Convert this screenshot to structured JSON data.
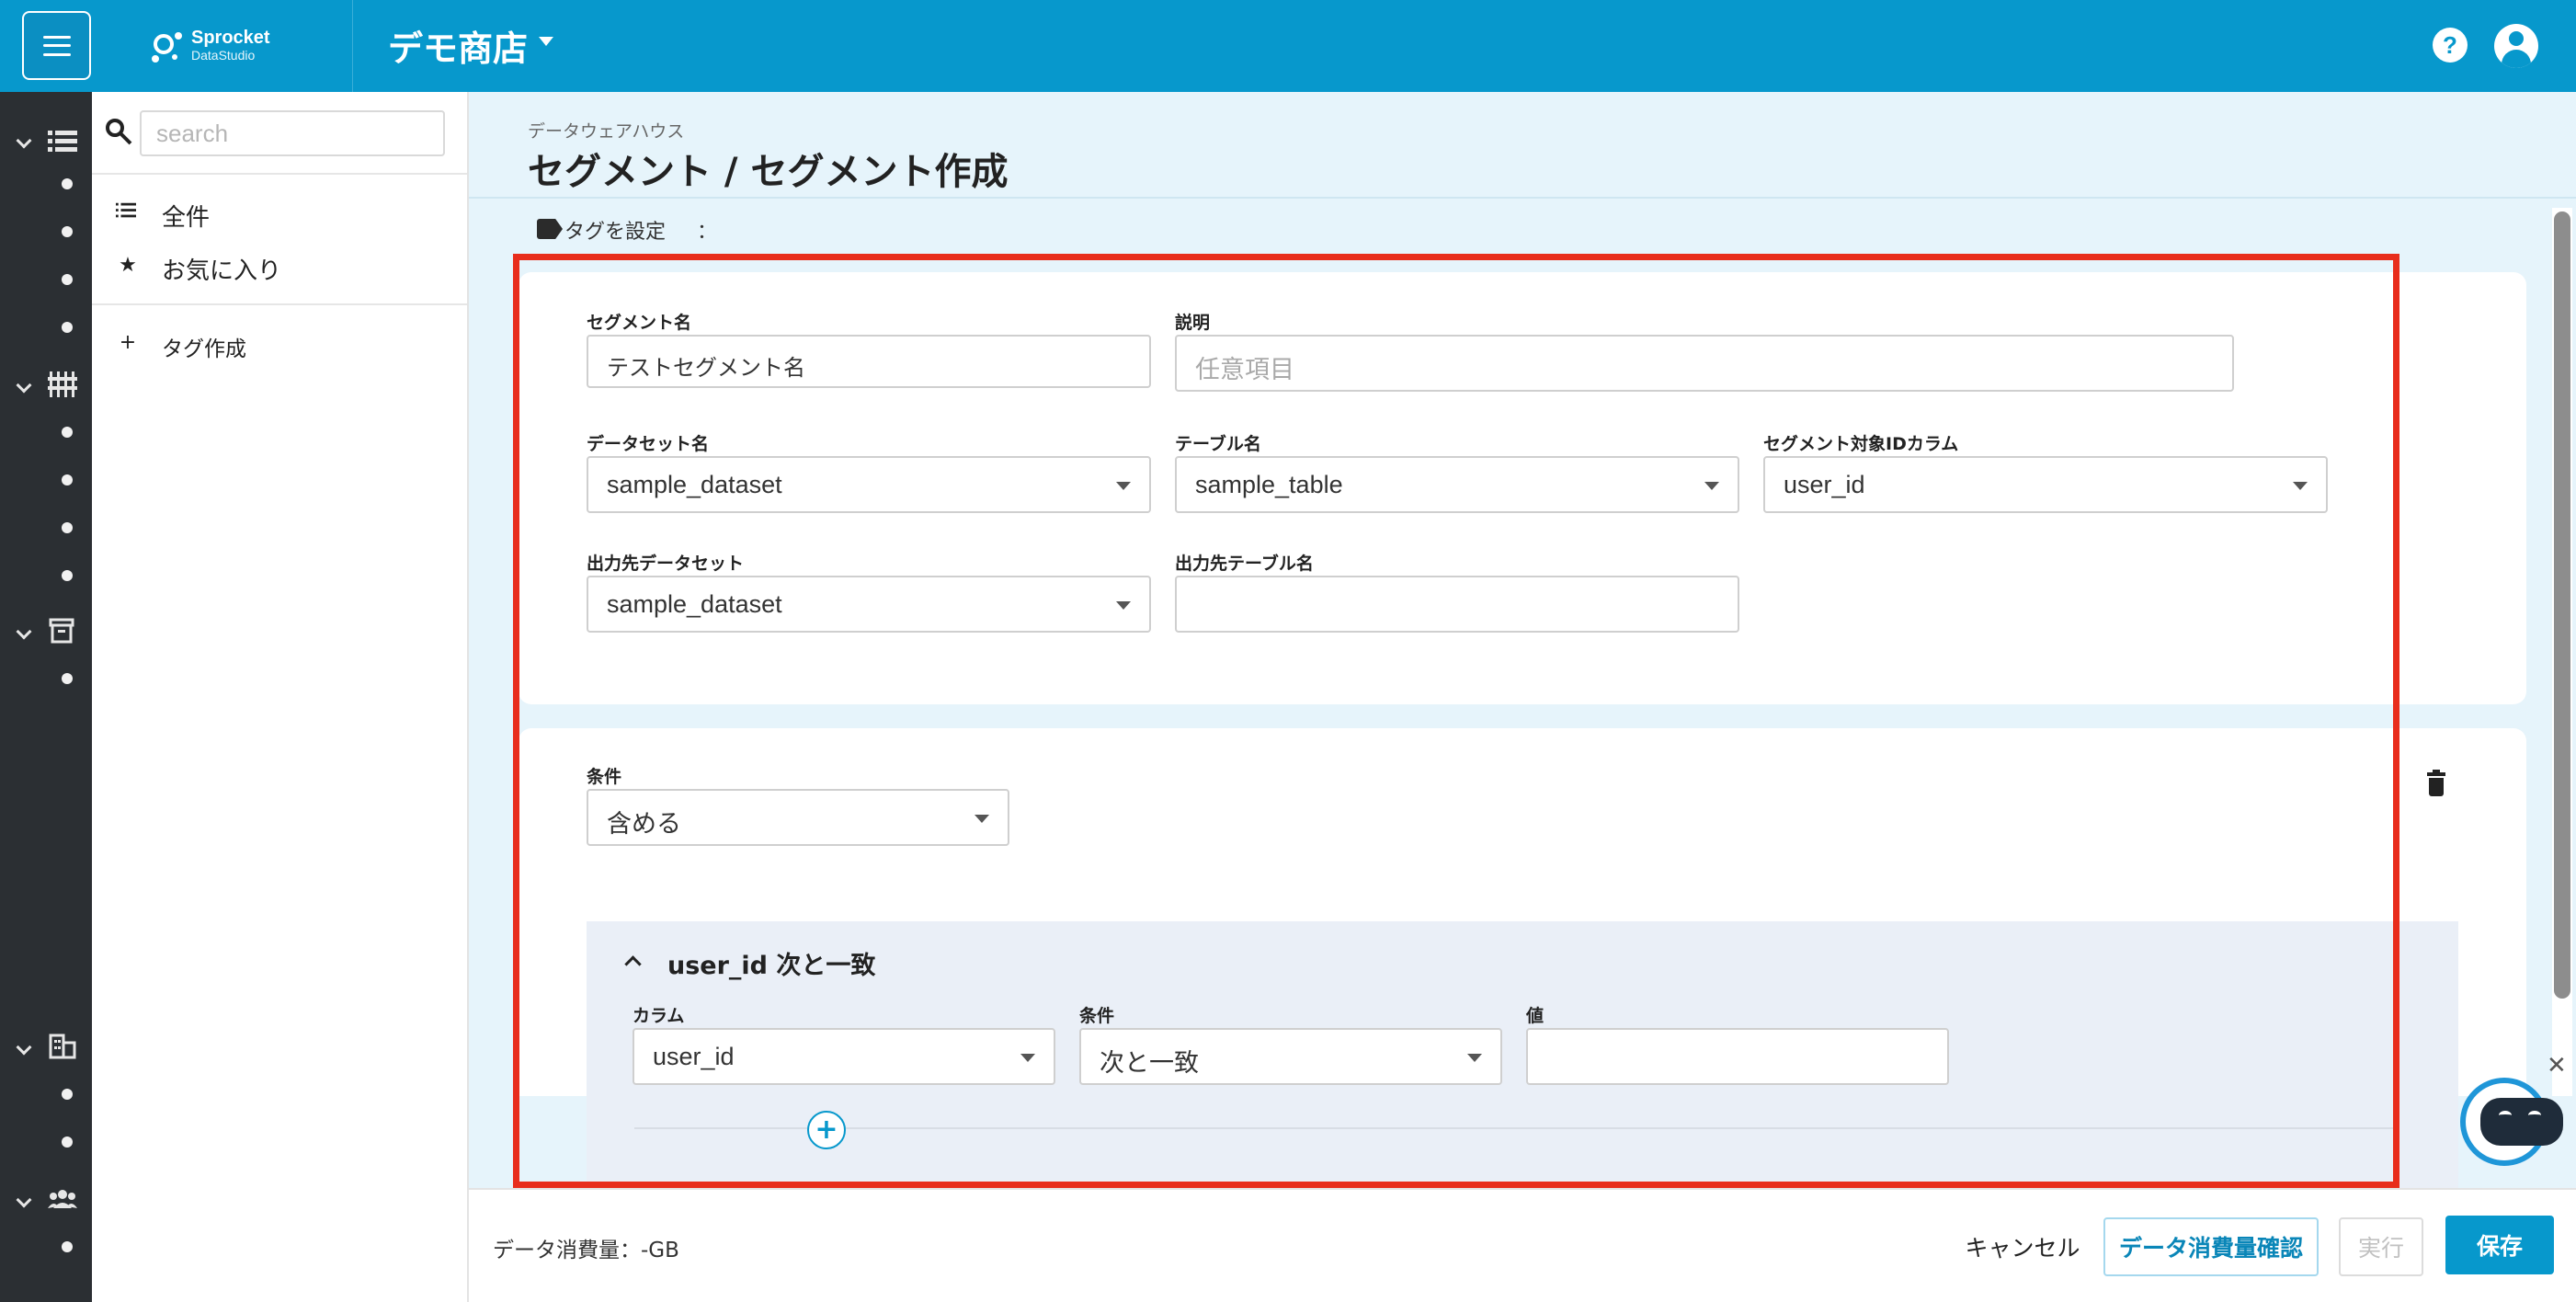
{
  "app": {
    "logo_name": "Sprocket",
    "logo_sub": "DataStudio",
    "shop_name": "デモ商店"
  },
  "sidebar": {
    "search_placeholder": "search",
    "items": [
      {
        "icon": "list-icon",
        "label": "全件"
      },
      {
        "icon": "star-icon",
        "label": "お気に入り"
      },
      {
        "icon": "plus-icon",
        "label": "タグ作成"
      }
    ]
  },
  "page": {
    "breadcrumb": "データウェアハウス",
    "title": "セグメント / セグメント作成",
    "tag_setting_label": "タグを設定",
    "tag_setting_colon": "："
  },
  "form": {
    "segment_name_label": "セグメント名",
    "segment_name_value": "テストセグメント名",
    "description_label": "説明",
    "description_placeholder": "任意項目",
    "dataset_label": "データセット名",
    "dataset_value": "sample_dataset",
    "table_label": "テーブル名",
    "table_value": "sample_table",
    "id_column_label": "セグメント対象IDカラム",
    "id_column_value": "user_id",
    "output_dataset_label": "出力先データセット",
    "output_dataset_value": "sample_dataset",
    "output_table_label": "出力先テーブル名",
    "output_table_value": ""
  },
  "condition": {
    "label": "条件",
    "value": "含める",
    "rule_title": "user_id 次と一致",
    "column_label": "カラム",
    "column_value": "user_id",
    "operator_label": "条件",
    "operator_value": "次と一致",
    "value_label": "値",
    "value_value": "",
    "add_symbol": "+"
  },
  "footer": {
    "usage_text": "データ消費量：-GB",
    "cancel_label": "キャンセル",
    "check_label": "データ消費量確認",
    "run_label": "実行",
    "save_label": "保存"
  },
  "colors": {
    "brand": "#0798cc",
    "highlight_frame": "#e82d1c",
    "rail": "#2b2f33"
  }
}
